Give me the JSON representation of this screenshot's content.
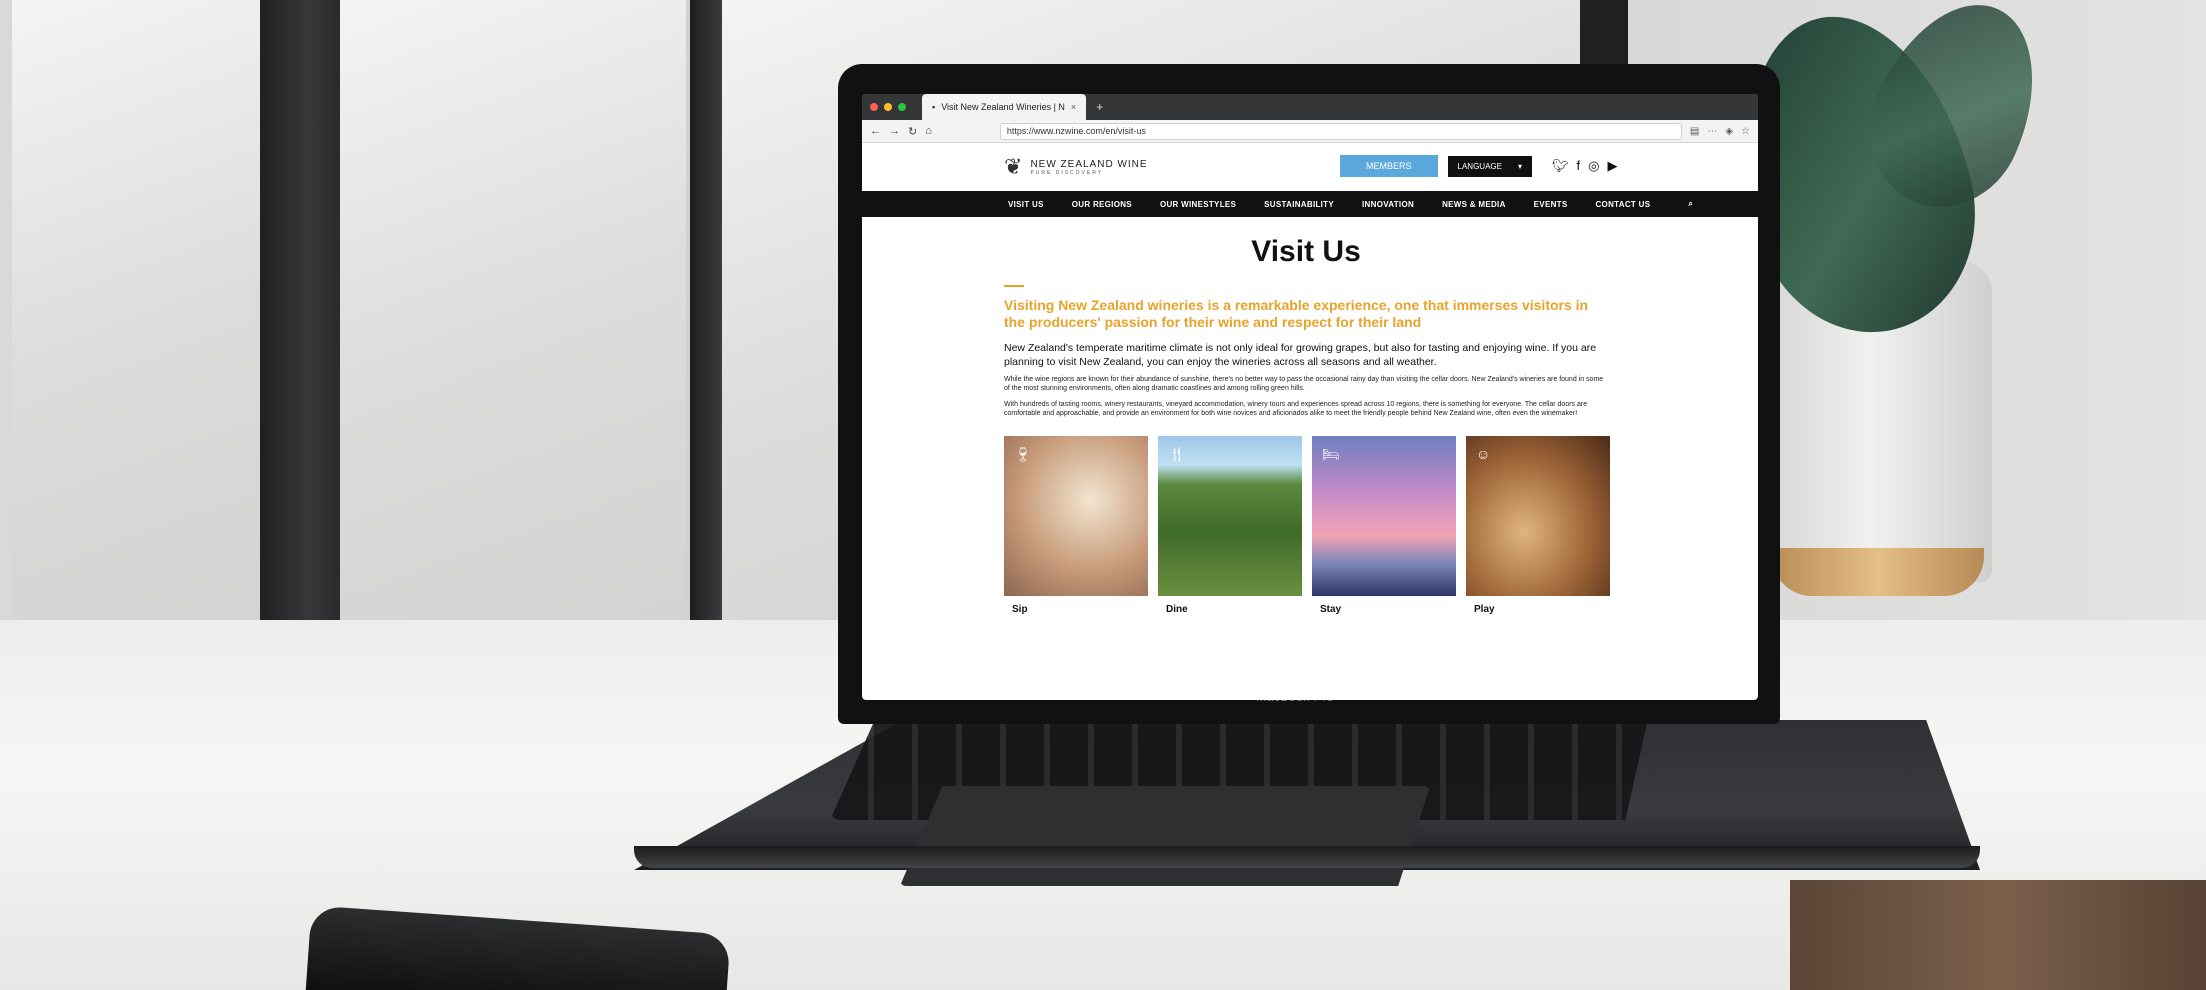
{
  "browser": {
    "tab_title": "Visit New Zealand Wineries | N",
    "tab_close": "×",
    "new_tab": "+",
    "url": "https://www.nzwine.com/en/visit-us"
  },
  "device": {
    "label": "MacBook Pro"
  },
  "site": {
    "logo_title": "NEW ZEALAND WINE",
    "logo_sub": "PURE DISCOVERY",
    "members_label": "MEMBERS",
    "language_label": "LANGUAGE",
    "nav": [
      "VISIT US",
      "OUR REGIONS",
      "OUR WINESTYLES",
      "SUSTAINABILITY",
      "INNOVATION",
      "NEWS & MEDIA",
      "EVENTS",
      "CONTACT US"
    ]
  },
  "page": {
    "title": "Visit Us",
    "lead": "Visiting New Zealand wineries is a remarkable experience, one that immerses visitors in the producers' passion for their wine and respect for their land",
    "intro": "New Zealand's temperate maritime climate is not only ideal for growing grapes, but also for tasting and enjoying wine. If you are planning to visit New Zealand, you can enjoy the wineries across all seasons and all weather.",
    "para1": "While the wine regions are known for their abundance of sunshine, there's no better way to pass the occasional rainy day than visiting the cellar doors. New Zealand's wineries are found in some of the most stunning environments, often along dramatic coastlines and among rolling green hills.",
    "para2": "With hundreds of tasting rooms, winery restaurants, vineyard accommodation, winery tours and experiences spread across 10 regions, there is something for everyone. The cellar doors are comfortable and approachable, and provide an environment for both wine novices and aficionados alike to meet the friendly people behind New Zealand wine, often even the winemaker!",
    "tiles": [
      {
        "label": "Sip",
        "icon": "wine-glass-icon"
      },
      {
        "label": "Dine",
        "icon": "cutlery-icon"
      },
      {
        "label": "Stay",
        "icon": "bed-icon"
      },
      {
        "label": "Play",
        "icon": "smile-icon"
      }
    ]
  },
  "colors": {
    "accent": "#e8a32a",
    "members": "#5ba8dc",
    "nav": "#111111"
  }
}
